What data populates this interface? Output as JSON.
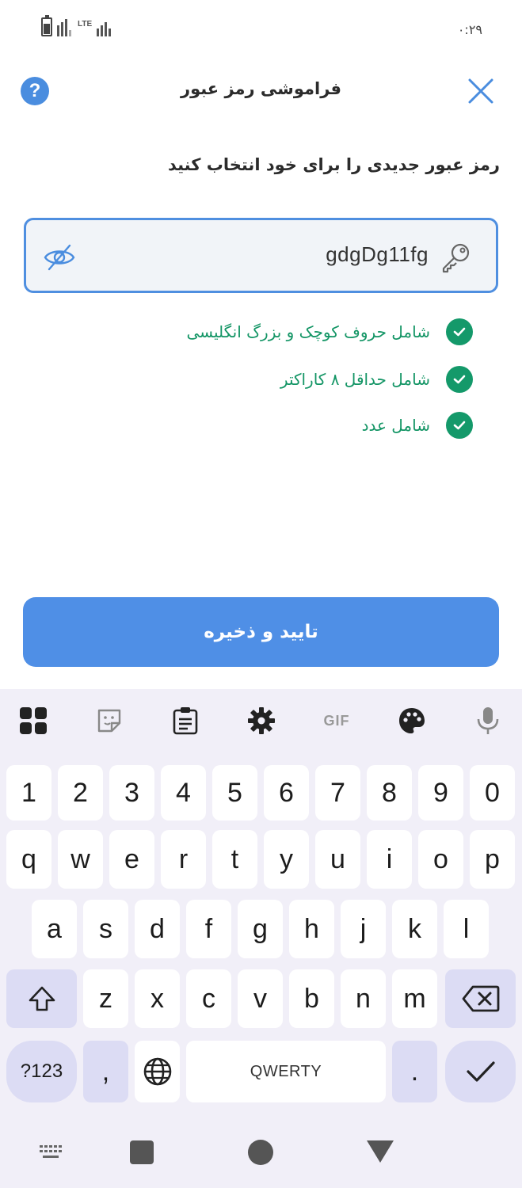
{
  "status_bar": {
    "network": "LTE",
    "time": "۰:۲۹"
  },
  "header": {
    "title": "فراموشی رمز عبور",
    "help_icon": "question-icon",
    "help_label": "?",
    "close_icon": "close-icon"
  },
  "instruction": "رمز عبور جدیدی را برای خود انتخاب کنید",
  "password_field": {
    "value": "gdgDg11fg",
    "leading_icon": "key-icon",
    "trailing_icon": "eye-off-icon",
    "border_color": "#4f8fe0"
  },
  "rules": [
    {
      "label": "شامل حروف کوچک و بزرگ انگلیسی",
      "satisfied": true
    },
    {
      "label": "شامل حداقل ۸ کاراکتر",
      "satisfied": true
    },
    {
      "label": "شامل عدد",
      "satisfied": true
    }
  ],
  "rule_color": "#14996a",
  "save_button": {
    "label": "تایید و ذخیره",
    "color": "#4f8fe6"
  },
  "keyboard": {
    "toolbar": [
      "apps-grid-icon",
      "sticker-icon",
      "clipboard-icon",
      "settings-icon",
      "gif-icon",
      "palette-icon",
      "microphone-icon"
    ],
    "gif_label": "GIF",
    "row_numbers": [
      "1",
      "2",
      "3",
      "4",
      "5",
      "6",
      "7",
      "8",
      "9",
      "0"
    ],
    "row_1": [
      "q",
      "w",
      "e",
      "r",
      "t",
      "y",
      "u",
      "i",
      "o",
      "p"
    ],
    "row_2": [
      "a",
      "s",
      "d",
      "f",
      "g",
      "h",
      "j",
      "k",
      "l"
    ],
    "row_3": [
      "z",
      "x",
      "c",
      "v",
      "b",
      "n",
      "m"
    ],
    "symbols_label": "?123",
    "comma_label": ",",
    "space_label": "QWERTY",
    "period_label": ".",
    "shift_icon": "shift-icon",
    "backspace_icon": "backspace-icon",
    "language_icon": "globe-icon",
    "enter_icon": "checkmark-icon"
  },
  "nav_bar": [
    "keyboard-switch-icon",
    "recents-icon",
    "home-icon",
    "back-icon"
  ]
}
